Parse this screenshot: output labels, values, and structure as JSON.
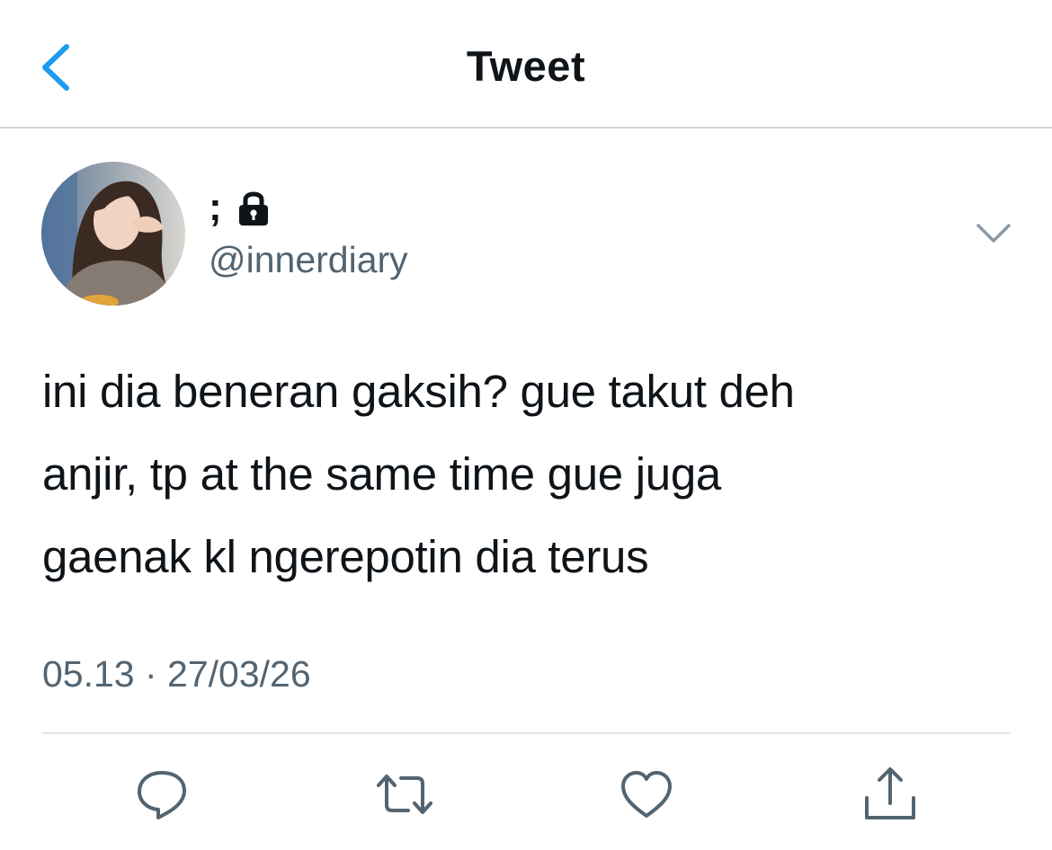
{
  "header": {
    "back_icon": "chevron-left-icon",
    "title": "Tweet",
    "accent_color": "#1d9bf0"
  },
  "tweet": {
    "author": {
      "display_name": ";",
      "protected_icon": "lock-icon",
      "handle": "@innerdiary",
      "avatar": "profile-photo"
    },
    "menu_icon": "chevron-down-icon",
    "text_lines": [
      "ini dia beneran gaksih? gue takut deh",
      "anjir, tp at the same time gue juga",
      "gaenak kl ngerepotin dia terus"
    ],
    "timestamp": "05.13 · 27/03/26"
  },
  "actions": [
    {
      "name": "reply",
      "icon": "speech-bubble-icon"
    },
    {
      "name": "retweet",
      "icon": "retweet-arrows-icon"
    },
    {
      "name": "like",
      "icon": "heart-icon"
    },
    {
      "name": "share",
      "icon": "share-upload-icon"
    }
  ],
  "colors": {
    "text_primary": "#0f1419",
    "text_secondary": "#536471",
    "icon_gray": "#536471",
    "divider": "#dfe3e7"
  }
}
